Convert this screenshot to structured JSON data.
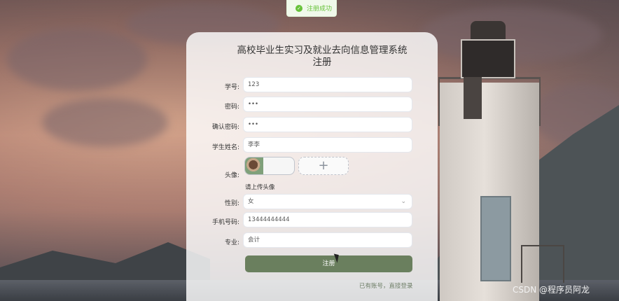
{
  "toast": {
    "icon": "check-circle-icon",
    "text": "注册成功"
  },
  "form": {
    "title": "高校毕业生实习及就业去向信息管理系统注册",
    "fields": {
      "student_id": {
        "label": "学号:",
        "value": "123"
      },
      "password": {
        "label": "密码:",
        "value": "•••"
      },
      "confirm_password": {
        "label": "确认密码:",
        "value": "•••"
      },
      "student_name": {
        "label": "学生姓名:",
        "value": "李李"
      },
      "avatar": {
        "label": "头像:",
        "hint": "请上传头像",
        "upload_icon": "+"
      },
      "gender": {
        "label": "性别:",
        "value": "女",
        "chevron": "⌄"
      },
      "phone": {
        "label": "手机号码:",
        "value": "13444444444"
      },
      "major": {
        "label": "专业:",
        "value": "会计"
      }
    },
    "submit_label": "注册",
    "login_link": "已有账号，直接登录"
  },
  "watermark": "CSDN @程序员阿龙",
  "colors": {
    "primary": "#6a7f5e",
    "success": "#67c23a",
    "card": "rgba(255,255,255,0.82)"
  }
}
